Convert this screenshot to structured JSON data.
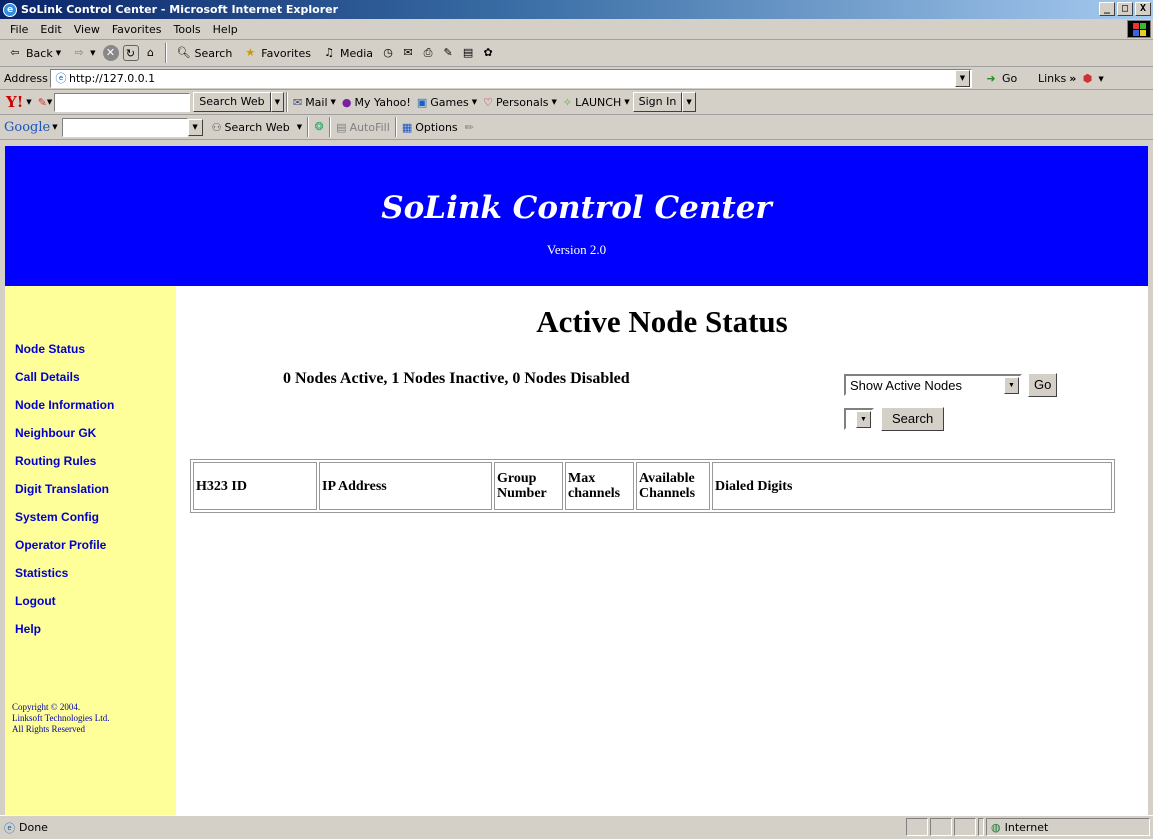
{
  "window": {
    "title": "SoLink Control Center - Microsoft Internet Explorer",
    "btn_min": "_",
    "btn_max": "□",
    "btn_close": "X"
  },
  "menu": {
    "items": [
      "File",
      "Edit",
      "View",
      "Favorites",
      "Tools",
      "Help"
    ]
  },
  "toolbar": {
    "back": "Back",
    "search": "Search",
    "favorites": "Favorites",
    "media": "Media"
  },
  "address": {
    "label": "Address",
    "url": "http://127.0.0.1",
    "go": "Go",
    "links": "Links"
  },
  "yahoo": {
    "logo": "Y!",
    "search_btn": "Search Web",
    "mail": "Mail",
    "my_yahoo": "My Yahoo!",
    "games": "Games",
    "personals": "Personals",
    "launch": "LAUNCH",
    "sign_in": "Sign In"
  },
  "google": {
    "logo": "Google",
    "search_btn": "Search Web",
    "autofill": "AutoFill",
    "options": "Options"
  },
  "banner": {
    "title": "SoLink Control Center",
    "version": "Version 2.0"
  },
  "sidebar": {
    "items": [
      "Node Status",
      "Call Details",
      "Node Information",
      "Neighbour GK",
      "Routing Rules",
      "Digit Translation",
      "System Config",
      "Operator Profile",
      "Statistics",
      "Logout",
      "Help"
    ],
    "copyright": [
      "Copyright © 2004.",
      "Linksoft Technologies Ltd.",
      "All Rights Reserved"
    ]
  },
  "main": {
    "heading": "Active Node Status",
    "summary": "0 Nodes Active, 1 Nodes Inactive, 0 Nodes Disabled",
    "filter_value": "Show Active Nodes",
    "go_button": "Go",
    "search_button": "Search",
    "table": {
      "headers": [
        [
          "H323 ID"
        ],
        [
          "IP Address"
        ],
        [
          "Group",
          "Number"
        ],
        [
          "Max",
          "channels"
        ],
        [
          "Available",
          "Channels"
        ],
        [
          "Dialed Digits"
        ]
      ]
    }
  },
  "status": {
    "left": "Done",
    "zone": "Internet"
  }
}
